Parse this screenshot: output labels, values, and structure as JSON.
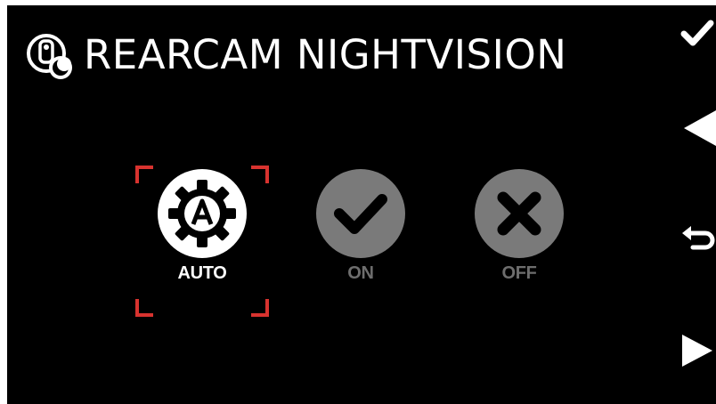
{
  "header": {
    "title": "REARCAM NIGHTVISION",
    "icon": "rear-camera-night-icon"
  },
  "options": [
    {
      "label": "AUTO",
      "icon": "gear-auto-icon",
      "selected": true
    },
    {
      "label": "ON",
      "icon": "check-icon",
      "selected": false
    },
    {
      "label": "OFF",
      "icon": "close-icon",
      "selected": false
    }
  ],
  "softkeys": {
    "confirm": "check-icon",
    "previous": "triangle-left-icon",
    "back": "back-arrow-icon",
    "next": "triangle-right-icon"
  },
  "colors": {
    "background": "#000000",
    "text": "#ffffff",
    "selection_bracket": "#d8332f",
    "inactive": "#7a7a7a"
  }
}
